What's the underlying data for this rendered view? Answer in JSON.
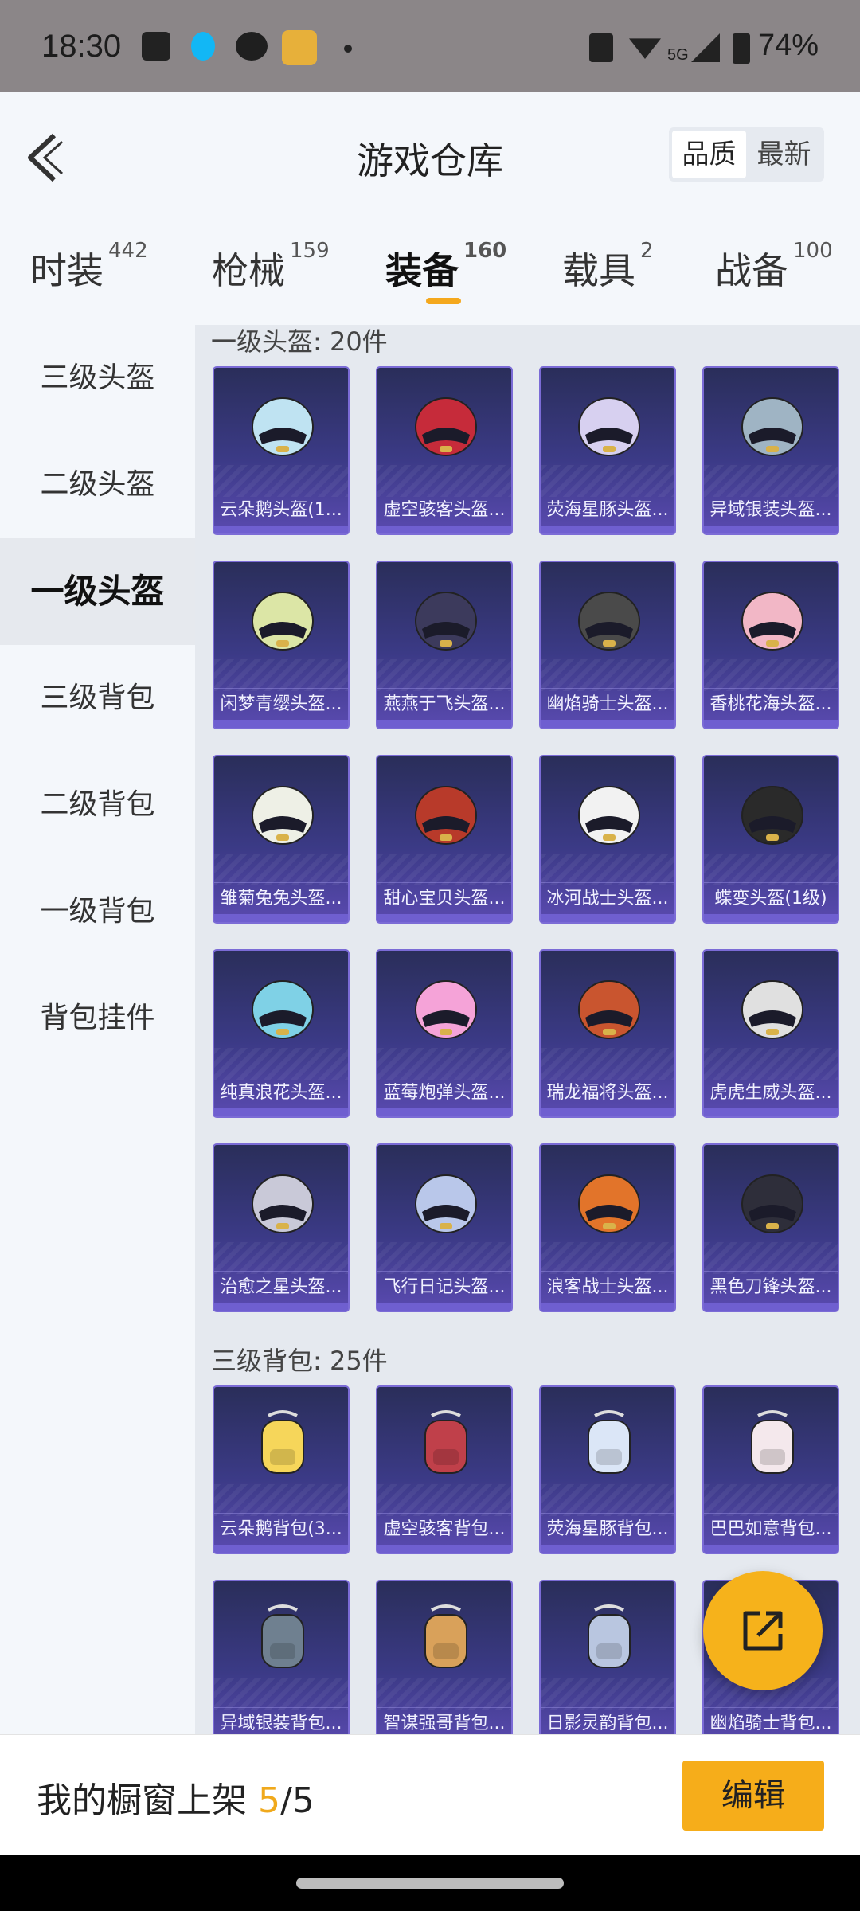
{
  "status_bar": {
    "time": "18:30",
    "battery": "74%",
    "network": "5G",
    "icons": [
      "message-icon",
      "qq-icon",
      "wechat-icon",
      "game-app-icon",
      "nfc-icon",
      "wifi-icon",
      "signal-icon",
      "battery-icon"
    ]
  },
  "header": {
    "title": "游戏仓库",
    "sort_quality": "品质",
    "sort_latest": "最新"
  },
  "tabs": [
    {
      "label": "时装",
      "count": "442"
    },
    {
      "label": "枪械",
      "count": "159"
    },
    {
      "label": "装备",
      "count": "160"
    },
    {
      "label": "载具",
      "count": "2"
    },
    {
      "label": "战备",
      "count": "100"
    }
  ],
  "active_tab": "装备",
  "sidebar": {
    "items": [
      "三级头盔",
      "二级头盔",
      "一级头盔",
      "三级背包",
      "二级背包",
      "一级背包",
      "背包挂件"
    ],
    "active": "一级头盔"
  },
  "sections": [
    {
      "title": "一级头盔: 20件",
      "items": [
        "云朵鹅头盔(1...",
        "虚空骇客头盔...",
        "荧海星豚头盔...",
        "异域银装头盔...",
        "闲梦青缨头盔...",
        "燕燕于飞头盔...",
        "幽焰骑士头盔...",
        "香桃花海头盔...",
        "雏菊兔兔头盔...",
        "甜心宝贝头盔...",
        "冰河战士头盔...",
        "蝶变头盔(1级)",
        "纯真浪花头盔...",
        "蓝莓炮弹头盔...",
        "瑞龙福将头盔...",
        "虎虎生威头盔...",
        "治愈之星头盔...",
        "飞行日记头盔...",
        "浪客战士头盔...",
        "黑色刀锋头盔..."
      ]
    },
    {
      "title": "三级背包: 25件",
      "items": [
        "云朵鹅背包(3...",
        "虚空骇客背包...",
        "荧海星豚背包...",
        "巴巴如意背包...",
        "异域银装背包...",
        "智谋强哥背包...",
        "日影灵韵背包...",
        "幽焰骑士背包..."
      ]
    }
  ],
  "colors": {
    "accent": "#f6ad1a",
    "card_bg_top": "#2a2e5a",
    "card_bg_bottom": "#5a4ab0"
  },
  "bottom_bar": {
    "label": "我的橱窗上架",
    "count": "5",
    "total": "/5",
    "edit_label": "编辑"
  }
}
